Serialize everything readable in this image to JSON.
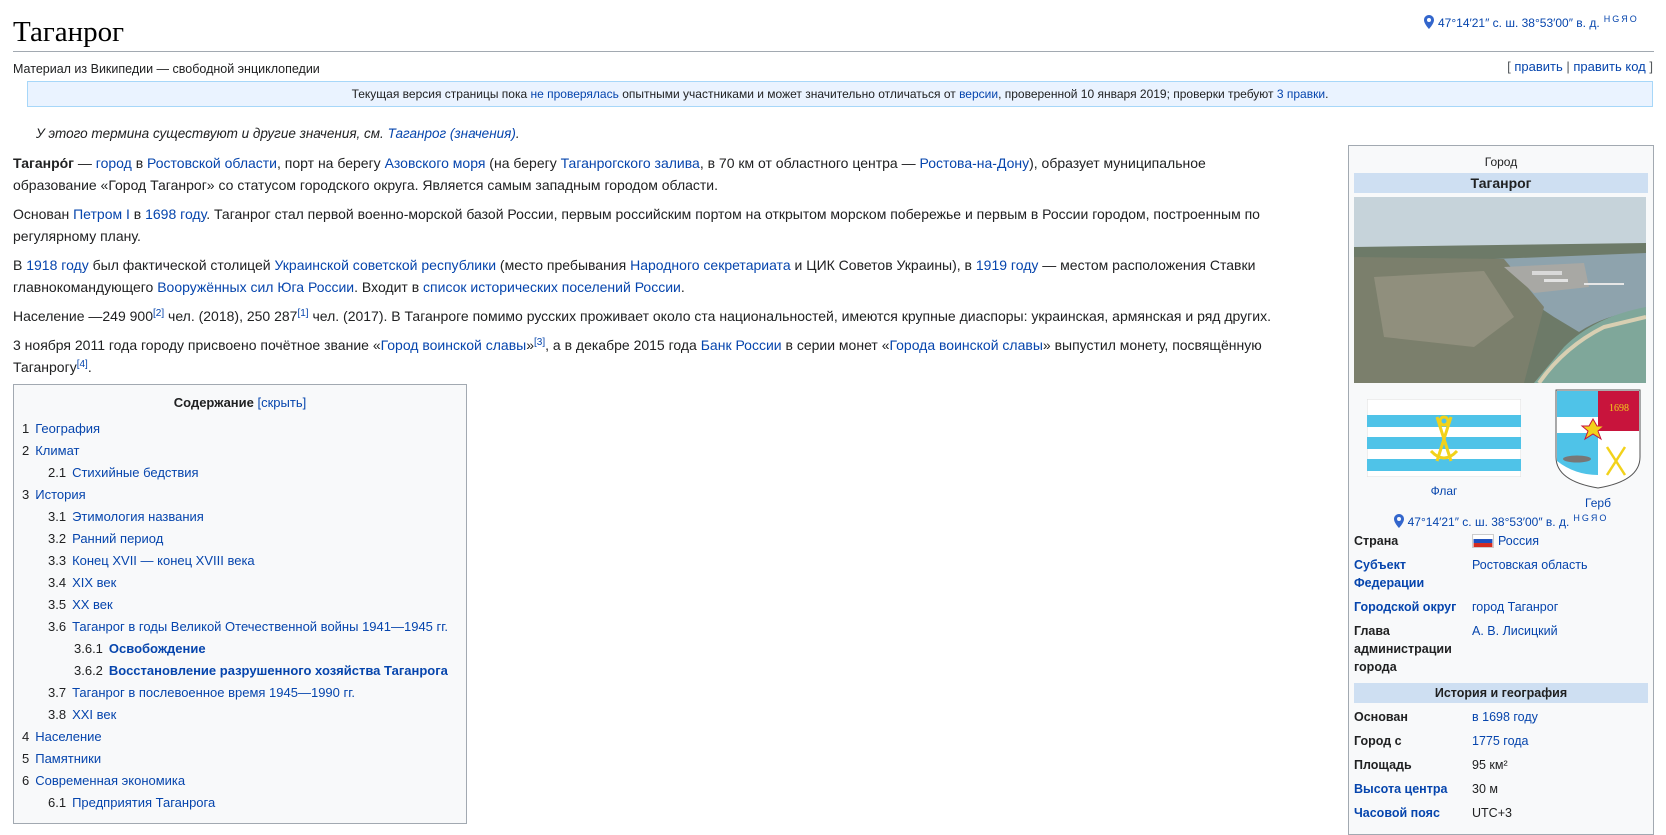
{
  "page": {
    "title": "Таганрог",
    "subtitle": "Материал из Википедии — свободной энциклопедии",
    "coords": "47°14′21″ с. ш. 38°53′00″ в. д.",
    "coord_links": [
      "H",
      "G",
      "Я",
      "O"
    ],
    "edit": {
      "open": "[",
      "edit_label": "править",
      "sep": "|",
      "edit_code_label": "править код",
      "close": "]"
    }
  },
  "review": {
    "t1": "Текущая версия страницы пока ",
    "l1": "не проверялась",
    "t2": " опытными участниками и может значительно отличаться от ",
    "l2": "версии",
    "t3": ", проверенной 10 января 2019; проверки требуют ",
    "l3": "3 правки",
    "t4": "."
  },
  "hatnote": {
    "text": "У этого термина существуют и другие значения, см. ",
    "link": "Таганрог (значения)",
    "end": "."
  },
  "paragraphs": {
    "p1": {
      "bold": "Таганро́г",
      "t1": " — ",
      "l1": "город",
      "t2": " в ",
      "l2": "Ростовской области",
      "t3": ", порт на берегу ",
      "l3": "Азовского моря",
      "t4": " (на берегу ",
      "l4": "Таганрогского залива",
      "t5": ", в 70 км от областного центра — ",
      "l5": "Ростова-на-Дону",
      "t6": "), образует муниципальное образование «Город Таганрог» со статусом городского округа. Является самым западным городом области."
    },
    "p2": {
      "t1": "Основан ",
      "l1": "Петром I",
      "t2": " в ",
      "l2": "1698 году",
      "t3": ". Таганрог стал первой военно-морской базой России, первым российским портом на открытом морском побережье и первым в России городом, построенным по регулярному плану."
    },
    "p3": {
      "t1": "В ",
      "l1": "1918 году",
      "t2": " был фактической столицей ",
      "l2": "Украинской советской республики",
      "t3": " (место пребывания ",
      "l3": "Народного секретариата",
      "t4": " и ЦИК Советов Украины), в ",
      "l4": "1919 году",
      "t5": " — местом расположения Ставки главнокомандующего ",
      "l5": "Вооружённых сил Юга России",
      "t6": ". Входит в ",
      "l6": "список исторических поселений России",
      "t7": "."
    },
    "p4": {
      "t1": "Население —249 900",
      "s1": "[2]",
      "t2": " чел. (2018), 250 287",
      "s2": "[1]",
      "t3": " чел. (2017). В Таганроге помимо русских проживает около ста национальностей, имеются крупные диаспоры: украинская, армянская и ряд других."
    },
    "p5": {
      "t1": "3 ноября 2011 года городу присвоено почётное звание «",
      "l1": "Город воинской славы",
      "t2": "»",
      "s1": "[3]",
      "t3": ", а в декабре 2015 года ",
      "l2": "Банк России",
      "t4": " в серии монет «",
      "l3": "Города воинской славы",
      "t5": "» выпустил монету, посвящённую Таганрогу",
      "s2": "[4]",
      "t6": "."
    }
  },
  "toc": {
    "title": "Содержание",
    "toggle": "[скрыть]",
    "items": [
      {
        "num": "1",
        "label": "География"
      },
      {
        "num": "2",
        "label": "Климат"
      },
      {
        "num": "2.1",
        "label": "Стихийные бедствия"
      },
      {
        "num": "3",
        "label": "История"
      },
      {
        "num": "3.1",
        "label": "Этимология названия"
      },
      {
        "num": "3.2",
        "label": "Ранний период"
      },
      {
        "num": "3.3",
        "label": "Конец XVII — конец XVIII века"
      },
      {
        "num": "3.4",
        "label": "XIX век"
      },
      {
        "num": "3.5",
        "label": "XX век"
      },
      {
        "num": "3.6",
        "label": "Таганрог в годы Великой Отечественной войны 1941—1945 гг."
      },
      {
        "num": "3.6.1",
        "label": "Освобождение"
      },
      {
        "num": "3.6.2",
        "label": "Восстановление разрушенного хозяйства Таганрога"
      },
      {
        "num": "3.7",
        "label": "Таганрог в послевоенное время 1945—1990 гг."
      },
      {
        "num": "3.8",
        "label": "XXI век"
      },
      {
        "num": "4",
        "label": "Население"
      },
      {
        "num": "5",
        "label": "Памятники"
      },
      {
        "num": "6",
        "label": "Современная экономика"
      },
      {
        "num": "6.1",
        "label": "Предприятия Таганрога"
      }
    ]
  },
  "infobox": {
    "type": "Город",
    "name": "Таганрог",
    "flag_caption": "Флаг",
    "coa_caption": "Герб",
    "coa_year": "1698",
    "coords": "47°14′21″ с. ш. 38°53′00″ в. д.",
    "rows": {
      "country_k": "Страна",
      "country_v": "Россия",
      "subject_k": "Субъект Федерации",
      "subject_v": "Ростовская область",
      "district_k": "Городской округ",
      "district_v": "город Таганрог",
      "head_k": "Глава администрации города",
      "head_v": "А. В. Лисицкий"
    },
    "section_history": "История и география",
    "history": {
      "founded_k": "Основан",
      "founded_v": "в 1698 году",
      "city_since_k": "Город с",
      "city_since_v": "1775 года",
      "area_k": "Площадь",
      "area_v": "95 км²",
      "height_k": "Высота центра",
      "height_v": "30 м",
      "tz_k": "Часовой пояс",
      "tz_v": "UTC+3"
    }
  },
  "colors": {
    "link": "#0645ad",
    "accent_header": "#cedff2",
    "review_bg": "#eaf3ff"
  }
}
